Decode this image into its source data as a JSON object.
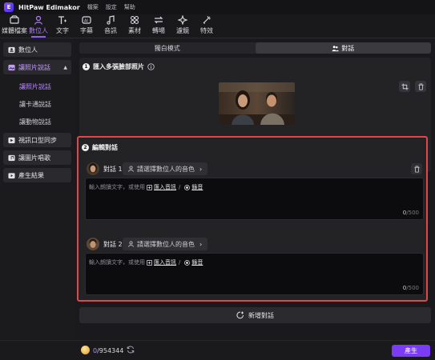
{
  "app": {
    "title": "HitPaw Edimakor",
    "logo_letter": "E",
    "menu": [
      "檔案",
      "設定",
      "幫助"
    ]
  },
  "toolbar": {
    "items": [
      {
        "label": "媒體檔案",
        "icon": "media-icon"
      },
      {
        "label": "數位人",
        "icon": "digital-human-icon",
        "active": true
      },
      {
        "label": "文字",
        "icon": "text-icon"
      },
      {
        "label": "字幕",
        "icon": "subtitle-icon"
      },
      {
        "label": "音訊",
        "icon": "audio-icon"
      },
      {
        "label": "素材",
        "icon": "assets-icon"
      },
      {
        "label": "轉場",
        "icon": "transition-icon"
      },
      {
        "label": "濾鏡",
        "icon": "filter-icon"
      },
      {
        "label": "特效",
        "icon": "effects-icon"
      }
    ]
  },
  "sidebar": {
    "digital_human": "數位人",
    "photo_talk": "讓照片說話",
    "photo_talk_sub": [
      "讓照片說話",
      "讓卡通說話",
      "讓動物說話"
    ],
    "video_lipsync": "視訊口型同步",
    "photo_sing": "讓圖片唱歌",
    "results": "產生結果"
  },
  "mode_tabs": {
    "monologue": "獨白模式",
    "dialogue": "對話"
  },
  "step1": {
    "number": "1",
    "title": "匯入多張臉部照片"
  },
  "step2": {
    "number": "2",
    "title": "編輯對話",
    "dialogs": [
      {
        "name": "對話 1",
        "voice_button": "請選擇數位人的音色",
        "placeholder": "輸入朗讀文字，或使用",
        "import_audio": "匯入音訊",
        "separator": "/",
        "record": "錄音",
        "count": "0",
        "max": "/500"
      },
      {
        "name": "對話 2",
        "voice_button": "請選擇數位人的音色",
        "placeholder": "輸入朗讀文字，或使用",
        "import_audio": "匯入音訊",
        "separator": "/",
        "record": "錄音",
        "count": "0",
        "max": "/500"
      }
    ]
  },
  "add_dialog": "新增對話",
  "footer": {
    "credits_used": "0",
    "credits_total": "/954344",
    "generate": "產生"
  },
  "colors": {
    "accent": "#8f5aff",
    "highlight_border": "#e0474c",
    "generate_button": "#7b3cf5"
  }
}
